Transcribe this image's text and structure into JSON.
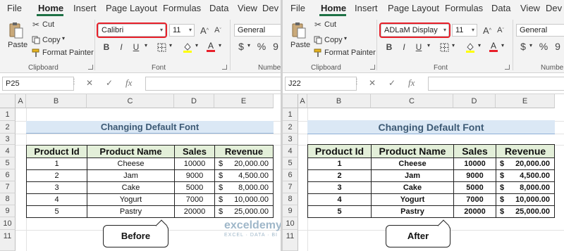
{
  "ribbon": {
    "tabs": [
      "File",
      "Home",
      "Insert",
      "Page Layout",
      "Formulas",
      "Data",
      "View",
      "Dev"
    ],
    "clipboard": {
      "paste": "Paste",
      "cut": "Cut",
      "copy": "Copy",
      "format_painter": "Format Painter",
      "group": "Clipboard"
    },
    "font": {
      "size": "11",
      "group": "Font",
      "bold": "B",
      "italic": "I",
      "underline": "U"
    },
    "number": {
      "format": "General",
      "group": "Numbe",
      "group_right": "Numbe",
      "dollar": "$",
      "percent": "%",
      "comma": "9"
    },
    "icons": [
      "scissors-icon",
      "copy-icon",
      "paintbrush-icon",
      "paste-icon",
      "grow-font-icon",
      "shrink-font-icon",
      "borders-icon",
      "fill-color-icon",
      "font-color-icon",
      "fx-icon",
      "cancel-icon",
      "enter-icon"
    ],
    "accent_color": "#1e7145",
    "highlight_color": "#e8202a"
  },
  "grid": {
    "columns": [
      "A",
      "B",
      "C",
      "D",
      "E"
    ],
    "rows": [
      "1",
      "2",
      "3",
      "4",
      "5",
      "6",
      "7",
      "8",
      "9",
      "10",
      "11"
    ],
    "fx_label": "fx",
    "cancel_glyph": "✕",
    "enter_glyph": "✓"
  },
  "table": {
    "title": "Changing Default Font",
    "headers": [
      "Product Id",
      "Product Name",
      "Sales",
      "Revenue"
    ],
    "rows": [
      {
        "id": "1",
        "name": "Cheese",
        "sales": "10000",
        "currency": "$",
        "revenue": "20,000.00"
      },
      {
        "id": "2",
        "name": "Jam",
        "sales": "9000",
        "currency": "$",
        "revenue": "4,500.00"
      },
      {
        "id": "3",
        "name": "Cake",
        "sales": "5000",
        "currency": "$",
        "revenue": "8,000.00"
      },
      {
        "id": "4",
        "name": "Yogurt",
        "sales": "7000",
        "currency": "$",
        "revenue": "10,000.00"
      },
      {
        "id": "5",
        "name": "Pastry",
        "sales": "20000",
        "currency": "$",
        "revenue": "25,000.00"
      }
    ],
    "header_fill": "#e3efd9",
    "title_fill": "#dbe8f5"
  },
  "panes": {
    "left": {
      "font_name": "Calibri",
      "name_box": "P25",
      "callout": "Before"
    },
    "right": {
      "font_name": "ADLaM Display",
      "name_box": "J22",
      "callout": "After"
    }
  },
  "watermark": {
    "brand": "exceldemy",
    "tagline": "EXCEL · DATA · BI"
  }
}
